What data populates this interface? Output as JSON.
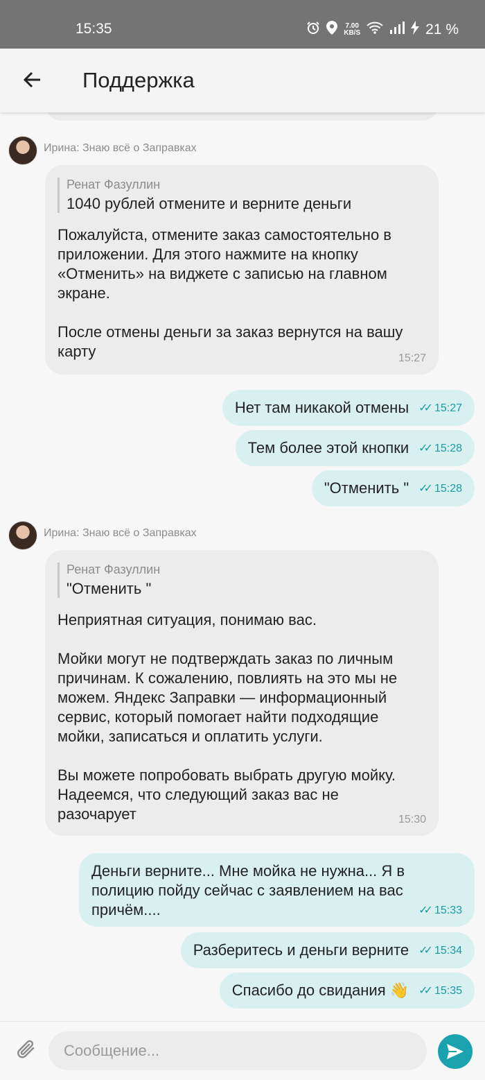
{
  "status_bar": {
    "time": "15:35",
    "net_speed_top": "7.00",
    "net_speed_bottom": "KB/S",
    "battery": "21 %",
    "icons": [
      "alarm-icon",
      "location-icon",
      "wifi-icon",
      "signal-icon",
      "charging-icon"
    ]
  },
  "header": {
    "title": "Поддержка",
    "back_icon": "arrow-left-icon"
  },
  "messages": [
    {
      "type": "incoming",
      "sender": "Ирина: Знаю всё о Заправках",
      "quote_author": "Ренат Фазуллин",
      "quote_text": "1040 рублей отмените и верните деньги",
      "text": "Пожалуйста, отмените заказ самостоятельно в\nприложении. Для этого нажмите на кнопку\n«Отменить» на виджете с записью на главном\nэкране.\n\nПосле отмены деньги за заказ вернутся на вашу\nкарту",
      "time": "15:27"
    },
    {
      "type": "outgoing",
      "text": "Нет там никакой отмены",
      "time": "15:27"
    },
    {
      "type": "outgoing",
      "text": "Тем более этой кнопки",
      "time": "15:28"
    },
    {
      "type": "outgoing",
      "text": "\"Отменить \"",
      "time": "15:28"
    },
    {
      "type": "incoming",
      "sender": "Ирина: Знаю всё о Заправках",
      "quote_author": "Ренат Фазуллин",
      "quote_text": "\"Отменить \"",
      "text": "Неприятная ситуация, понимаю вас.\n\nМойки могут не подтверждать заказ по личным\nпричинам. К сожалению, повлиять на это мы не\nможем. Яндекс Заправки — информационный\nсервис, который помогает найти подходящие\nмойки, записаться и оплатить услуги.\n\nВы можете попробовать выбрать другую мойку.\nНадеемся, что следующий заказ вас не\nразочарует",
      "time": "15:30"
    },
    {
      "type": "outgoing",
      "text": "Деньги верните... Мне мойка не нужна... Я в\nполицию пойду сейчас с заявлением на вас\nпричём....",
      "time": "15:33"
    },
    {
      "type": "outgoing",
      "text": "Разберитесь и деньги верните",
      "time": "15:34"
    },
    {
      "type": "outgoing",
      "text": "Спасибо до свидания 👋",
      "time": "15:35"
    }
  ],
  "composer": {
    "placeholder": "Сообщение...",
    "attach_icon": "paperclip-icon",
    "send_icon": "send-icon"
  },
  "colors": {
    "accent": "#1aa3ae",
    "outgoing_bubble": "#d9f0f1",
    "incoming_bubble": "#ececec",
    "status_bar": "#747474"
  }
}
